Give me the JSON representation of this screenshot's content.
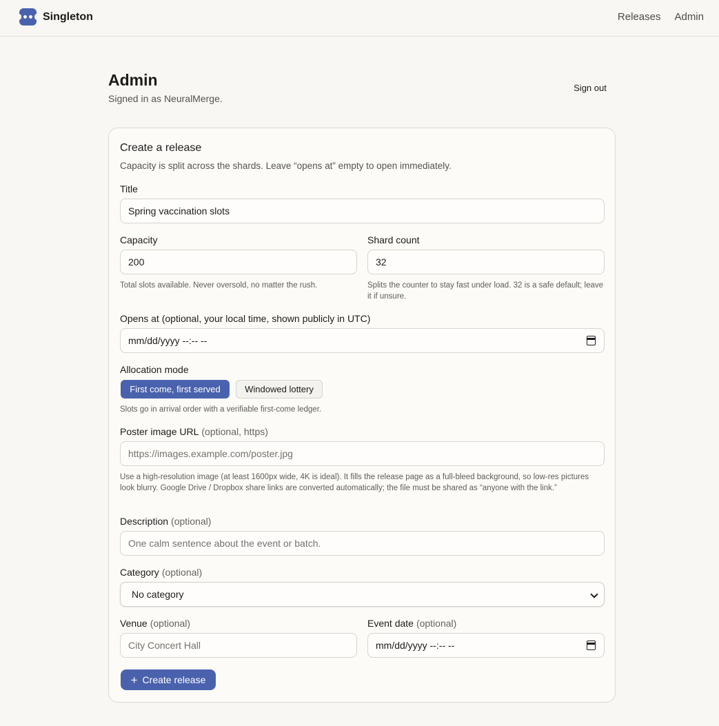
{
  "brand": {
    "name": "Singleton"
  },
  "nav": {
    "releases": "Releases",
    "admin": "Admin"
  },
  "header": {
    "title": "Admin",
    "subtitle": "Signed in as NeuralMerge.",
    "signout": "Sign out"
  },
  "form": {
    "title": "Create a release",
    "description": "Capacity is split across the shards. Leave “opens at” empty to open immediately.",
    "title_field": {
      "label": "Title",
      "value": "Spring vaccination slots"
    },
    "capacity": {
      "label": "Capacity",
      "value": "200",
      "help": "Total slots available. Never oversold, no matter the rush."
    },
    "shard_count": {
      "label": "Shard count",
      "value": "32",
      "help": "Splits the counter to stay fast under load. 32 is a safe default; leave it if unsure."
    },
    "opens_at": {
      "label": "Opens at (optional, your local time, shown publicly in UTC)",
      "placeholder": "mm/dd/yyyy --:-- --"
    },
    "allocation": {
      "label": "Allocation mode",
      "options": [
        "First come, first served",
        "Windowed lottery"
      ],
      "selected": "First come, first served",
      "help": "Slots go in arrival order with a verifiable first-come ledger."
    },
    "poster": {
      "label": "Poster image URL",
      "optional": "(optional, https)",
      "placeholder": "https://images.example.com/poster.jpg",
      "help": "Use a high-resolution image (at least 1600px wide, 4K is ideal). It fills the release page as a full-bleed background, so low-res pictures look blurry. Google Drive / Dropbox share links are converted automatically; the file must be shared as “anyone with the link.”"
    },
    "description_field": {
      "label": "Description",
      "optional": "(optional)",
      "placeholder": "One calm sentence about the event or batch."
    },
    "category": {
      "label": "Category",
      "optional": "(optional)",
      "value": "No category"
    },
    "venue": {
      "label": "Venue",
      "optional": "(optional)",
      "placeholder": "City Concert Hall"
    },
    "event_date": {
      "label": "Event date",
      "optional": "(optional)",
      "placeholder": "mm/dd/yyyy --:-- --"
    },
    "submit": "Create release"
  },
  "colors": {
    "accent": "#4a62ad",
    "background": "#f8f7f3"
  }
}
